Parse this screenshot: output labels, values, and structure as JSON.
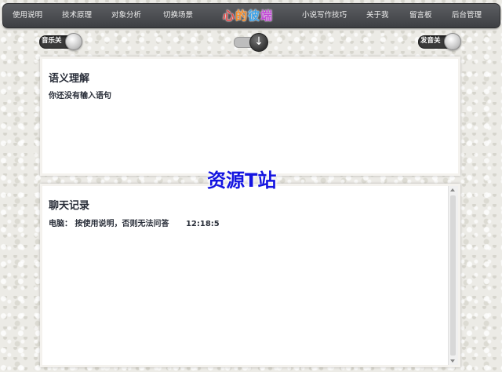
{
  "nav": {
    "items": [
      "使用说明",
      "技术原理",
      "对象分析",
      "切换场景",
      "小说写作技巧",
      "关于我",
      "留言板",
      "后台管理"
    ],
    "logo": [
      "心",
      "的",
      "彼",
      "端"
    ],
    "logo_colors": [
      "#e24a4a",
      "#f08a2a",
      "#3aa0e6",
      "#c24ad6"
    ]
  },
  "toggles": {
    "music_label": "音乐关",
    "voice_label": "发音关",
    "center_icon": "down-arrow-icon"
  },
  "semantic_panel": {
    "title": "语义理解",
    "text": "你还没有输入语句"
  },
  "watermark": "资源T站",
  "chat_panel": {
    "title": "聊天记录",
    "speaker": "电脑：",
    "message": "按使用说明，否则无法问答",
    "time": "12:18:5"
  }
}
